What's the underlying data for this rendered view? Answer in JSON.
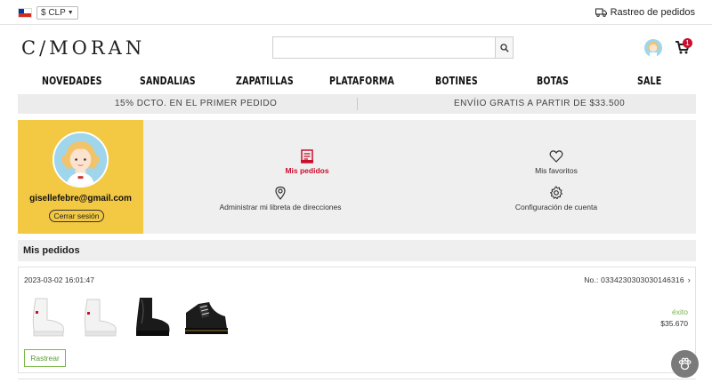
{
  "topbar": {
    "currency": "$ CLP",
    "tracking_label": "Rastreo de pedidos"
  },
  "header": {
    "logo": "C/MORAN",
    "search_placeholder": "",
    "cart_count": "1"
  },
  "nav": {
    "items": [
      "NOVEDADES",
      "SANDALIAS",
      "ZAPATILLAS",
      "PLATAFORMA",
      "BOTINES",
      "BOTAS",
      "SALE"
    ]
  },
  "promo": {
    "left": "15% DCTO. EN EL PRIMER PEDIDO",
    "right": "ENVÍIO GRATIS A PARTIR DE $33.500"
  },
  "account": {
    "email": "gisellefebre@gmail.com",
    "logout_label": "Cerrar sesión",
    "links": {
      "orders": "Mis pedidos",
      "favorites": "Mis favoritos",
      "addresses": "Administrar mi libreta de direcciones",
      "settings": "Configuración de cuenta"
    }
  },
  "orders_section": {
    "title": "Mis pedidos",
    "orders": [
      {
        "date": "2023-03-02 16:01:47",
        "number": "No.: 0334230303030146316",
        "status": "éxito",
        "total": "$35.670",
        "track_label": "Rastrear",
        "items": [
          "white-platform-boot-1",
          "white-platform-boot-2",
          "black-platform-boot",
          "black-lace-up-boot"
        ]
      }
    ]
  },
  "colors": {
    "accent_red": "#c8102e",
    "profile_yellow": "#f3c842",
    "success_green": "#7ab648",
    "panel_gray": "#efefef"
  }
}
